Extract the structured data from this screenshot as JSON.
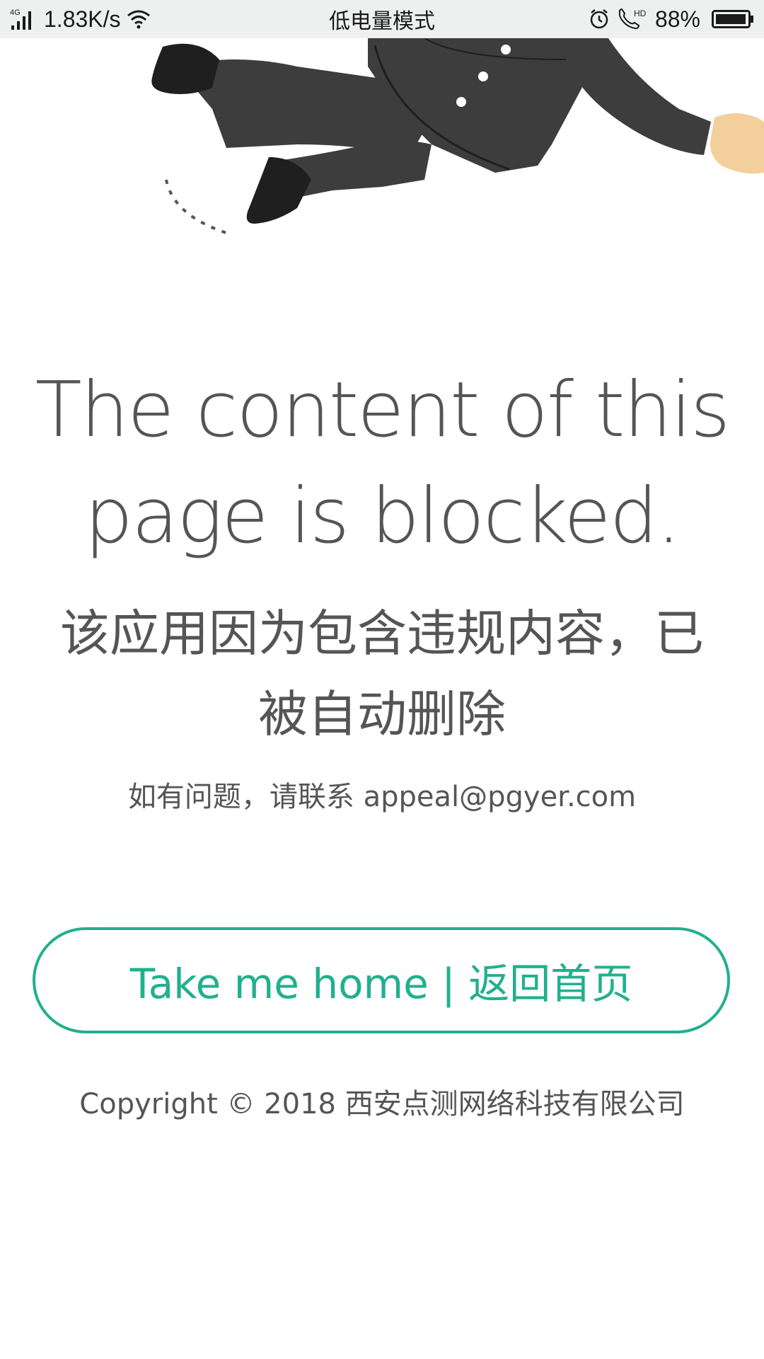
{
  "status_bar": {
    "network_type": "4G",
    "net_speed": "1.83K/s",
    "mode_text": "低电量模式",
    "call_badge": "HD",
    "battery_level": "88%",
    "icons": [
      "signal-icon",
      "wifi-icon",
      "alarm-icon",
      "hd-call-icon",
      "battery-icon"
    ]
  },
  "main": {
    "headline": "The content of this page is blocked.",
    "subtitle": "该应用因为包含违规内容，已被自动删除",
    "contact": "如有问题，请联系 appeal@pgyer.com"
  },
  "button": {
    "label": "Take me home | 返回首页"
  },
  "footer": {
    "copyright": "Copyright © 2018 西安点测网络科技有限公司"
  },
  "colors": {
    "accent": "#21b08d",
    "text": "#555555",
    "status_bar_bg": "#eef0ef"
  }
}
